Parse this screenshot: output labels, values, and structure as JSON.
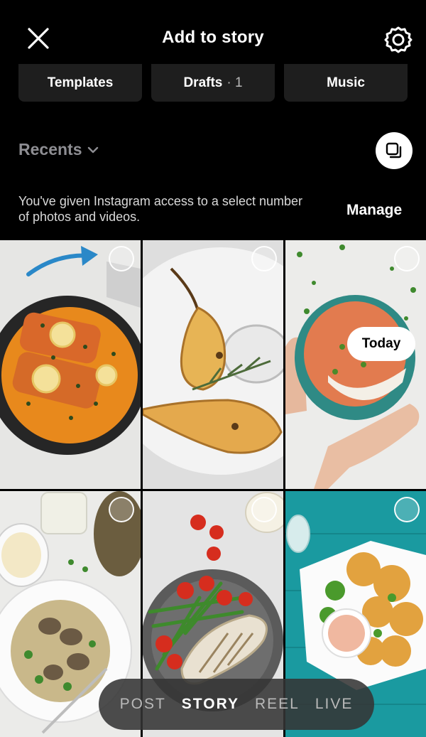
{
  "header": {
    "title": "Add to story",
    "close_icon": "close-icon",
    "settings_icon": "gear-icon"
  },
  "chips": [
    {
      "label": "Templates",
      "count": ""
    },
    {
      "label": "Drafts",
      "count": "· 1"
    },
    {
      "label": "Music",
      "count": ""
    }
  ],
  "gallery": {
    "album_label": "Recents",
    "album_icon": "chevron-down-icon",
    "multi_select_icon": "multi-select-icon",
    "access_notice": "You've given Instagram access to a select number of photos and videos.",
    "manage_label": "Manage",
    "today_label": "Today"
  },
  "photos": [
    {
      "subject": "salmon-curry-pan"
    },
    {
      "subject": "roasted-pears"
    },
    {
      "subject": "rice-bowl-hands"
    },
    {
      "subject": "mushroom-risotto"
    },
    {
      "subject": "chicken-green-beans"
    },
    {
      "subject": "nachos-dip"
    }
  ],
  "modes": {
    "post": "POST",
    "story": "STORY",
    "reel": "REEL",
    "live": "LIVE",
    "active": "STORY"
  },
  "colors": {
    "background": "#000000",
    "chip_bg": "#1e1e1e",
    "muted_text": "#8e8e93"
  }
}
